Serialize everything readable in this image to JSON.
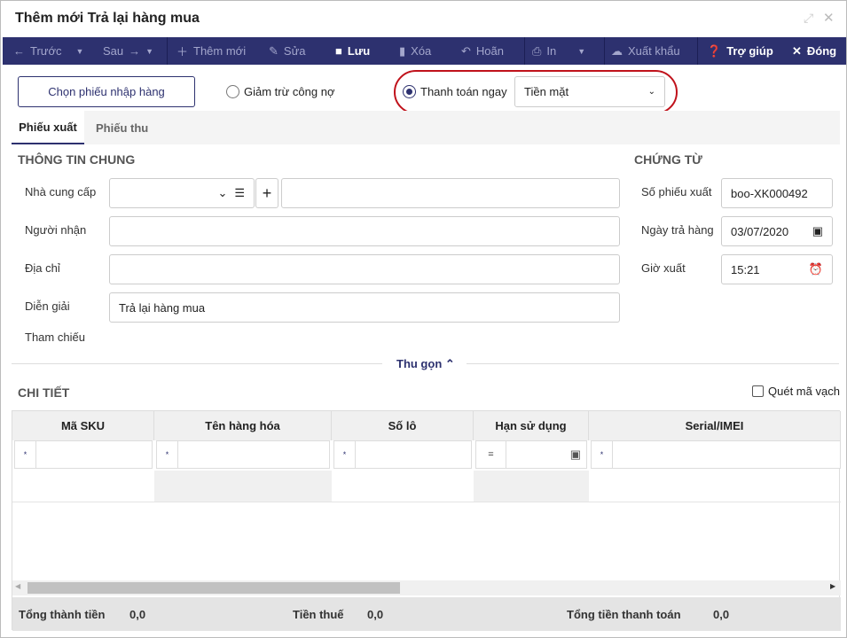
{
  "window": {
    "title": "Thêm mới Trả lại hàng mua"
  },
  "toolbar": {
    "prev": "Trước",
    "next": "Sau",
    "add": "Thêm mới",
    "edit": "Sửa",
    "save": "Lưu",
    "delete": "Xóa",
    "defer": "Hoãn",
    "print": "In",
    "export": "Xuất khẩu",
    "help": "Trợ giúp",
    "close": "Đóng"
  },
  "actions": {
    "choose_receipt": "Chọn phiếu nhập hàng",
    "debt_option": "Giảm trừ công nợ",
    "pay_now_option": "Thanh toán ngay",
    "payment_method": "Tiền mặt",
    "selected_option": "Thanh toán ngay"
  },
  "tabs": [
    {
      "label": "Phiếu xuất",
      "active": true
    },
    {
      "label": "Phiếu thu",
      "active": false
    }
  ],
  "general": {
    "heading": "THÔNG TIN CHUNG",
    "supplier_label": "Nhà cung cấp",
    "supplier_value": "",
    "supplier_name": "",
    "receiver_label": "Người nhận",
    "receiver_value": "",
    "address_label": "Địa chỉ",
    "address_value": "",
    "desc_label": "Diễn giải",
    "desc_value": "Trả lại hàng mua",
    "ref_label": "Tham chiếu"
  },
  "voucher": {
    "heading": "CHỨNG TỪ",
    "number_label": "Số phiếu xuất",
    "number_value": "boo-XK000492",
    "date_label": "Ngày trả hàng",
    "date_value": "03/07/2020",
    "time_label": "Giờ xuất",
    "time_value": "15:21"
  },
  "collapse": "Thu gọn",
  "detail": {
    "heading": "CHI TIẾT",
    "barcode_label": "Quét mã vạch",
    "columns": [
      "Mã SKU",
      "Tên hàng hóa",
      "Số lô",
      "Hạn sử dụng",
      "Serial/IMEI"
    ],
    "filter_ops": [
      "*",
      "*",
      "*",
      "=",
      "*"
    ]
  },
  "totals": {
    "subtotal_label": "Tổng thành tiền",
    "subtotal": "0,0",
    "tax_label": "Tiền thuế",
    "tax": "0,0",
    "total_label": "Tổng tiền thanh toán",
    "total": "0,0"
  },
  "colors": {
    "toolbar": "#2d316f",
    "highlight": "#c0121b"
  }
}
